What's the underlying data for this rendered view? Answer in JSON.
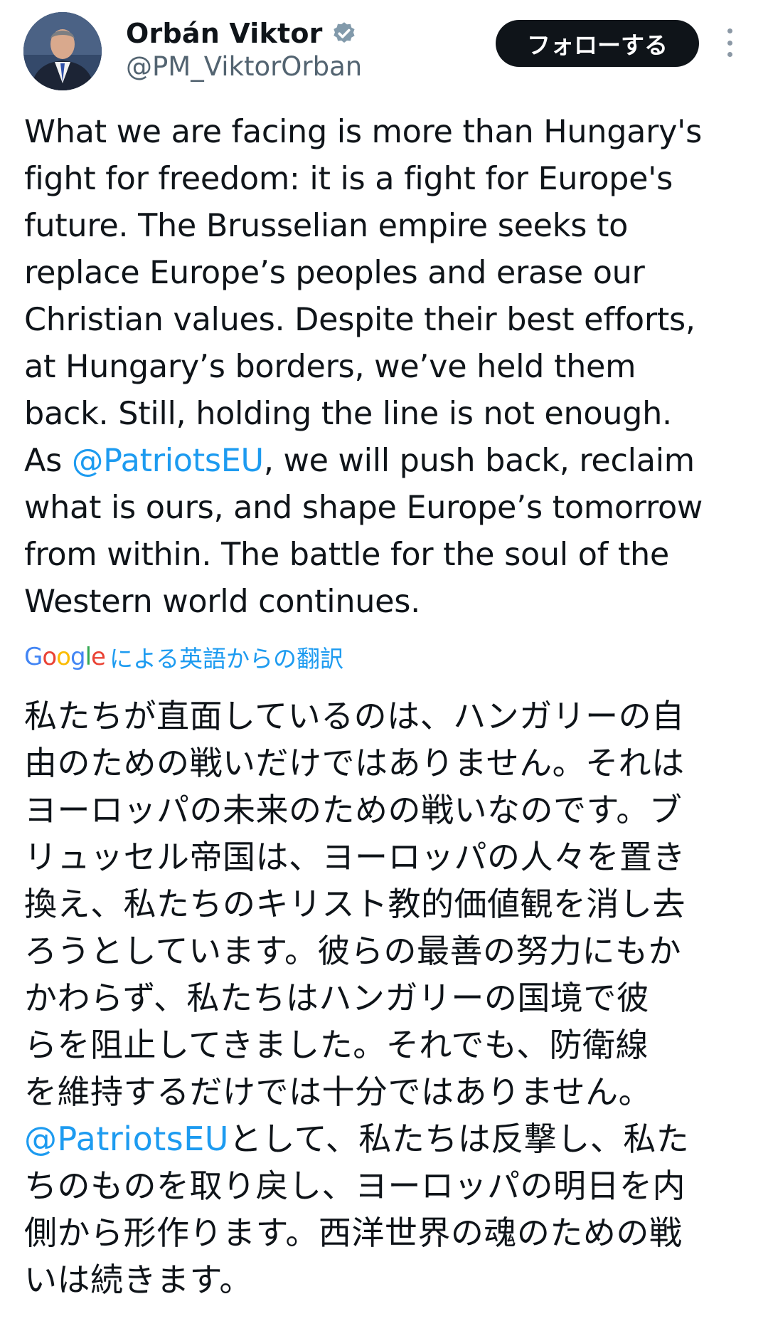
{
  "author": {
    "display_name": "Orbán Viktor",
    "handle": "@PM_ViktorOrban",
    "verified_icon": "verified-badge-icon"
  },
  "actions": {
    "follow_label": "フォローする",
    "more_icon": "more-options-icon"
  },
  "tweet": {
    "en_part1": "What we are facing is more than Hungary's\nfight for freedom: it is a fight for Europe's\nfuture. The Brusselian empire seeks to\nreplace Europe’s peoples and erase our\nChristian values. Despite their best efforts,\nat Hungary’s borders, we’ve held them\nback. Still, holding the line is not enough.\nAs ",
    "en_mention": "@PatriotsEU",
    "en_part2": ", we will push back, reclaim\nwhat is ours, and shape Europe’s tomorrow\nfrom within. The battle for the soul of the\nWestern world continues."
  },
  "translation": {
    "google_logo": "Google",
    "label": "による英語からの翻訳",
    "ja_part1": "私たちが直面しているのは、ハンガリーの自\n由のための戦いだけではありません。それは\nヨーロッパの未来のための戦いなのです。ブ\nリュッセル帝国は、ヨーロッパの人々を置き\n換え、私たちのキリスト教的価値観を消し去\nろうとしています。彼らの最善の努力にもか\nかわらず、私たちはハンガリーの国境で彼\nらを阻止してきました。それでも、防衛線\nを維持するだけでは十分ではありません。\n",
    "ja_mention": "@PatriotsEU",
    "ja_part2": "として、私たちは反撃し、私た\nちのものを取り戻し、ヨーロッパの明日を内\n側から形作ります。西洋世界の魂のための戦\nいは続きます。"
  },
  "colors": {
    "link": "#1d9bf0",
    "text": "#0f1419",
    "secondary": "#536471",
    "follow_bg": "#0f1419"
  }
}
